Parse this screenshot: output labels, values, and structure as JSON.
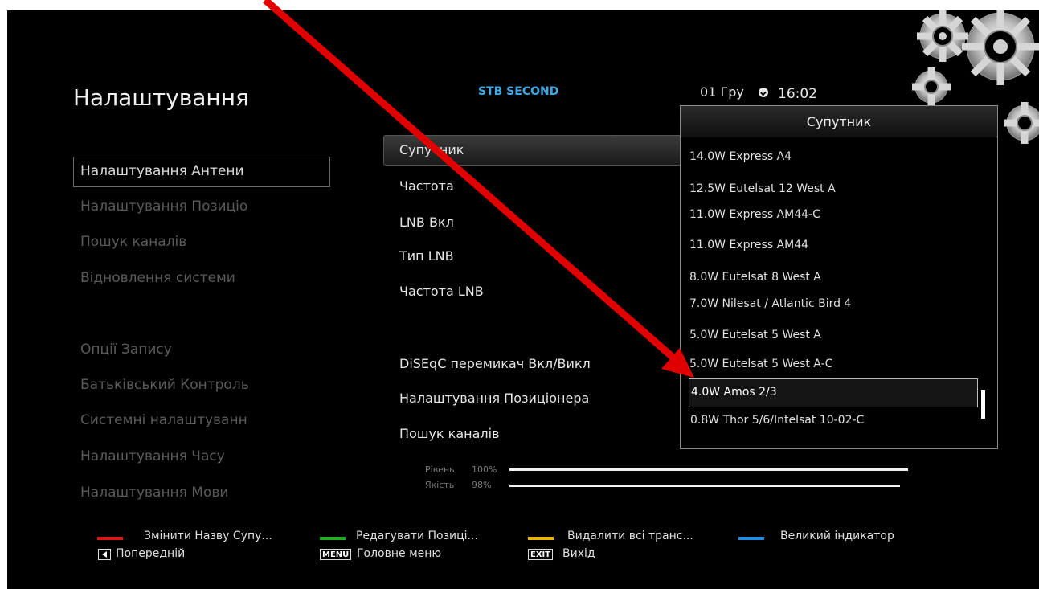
{
  "header": {
    "title": "Налаштування",
    "device_name": "STB SECOND",
    "date": "01 Гру",
    "time": "16:02"
  },
  "left_menu": {
    "items": [
      {
        "label": "Налаштування Антени",
        "active": true
      },
      {
        "label": "Налаштування Позиціо",
        "active": false
      },
      {
        "label": "Пошук каналів",
        "active": false
      },
      {
        "label": "Відновлення системи",
        "active": false
      },
      {
        "label": "Опції Запису",
        "active": false
      },
      {
        "label": "Батьківський Контроль",
        "active": false
      },
      {
        "label": "Системні налаштуванн",
        "active": false
      },
      {
        "label": "Налаштування Часу",
        "active": false
      },
      {
        "label": "Налаштування Мови",
        "active": false
      }
    ]
  },
  "settings": {
    "items": [
      {
        "label": "Супутник",
        "selected": true
      },
      {
        "label": "Частота"
      },
      {
        "label": "LNB Вкл"
      },
      {
        "label": "Тип LNB"
      },
      {
        "label": "Частота LNB"
      },
      {
        "label": "DiSEqC перемикач Вкл/Викл"
      },
      {
        "label": "Налаштування Позиціонера"
      },
      {
        "label": "Пошук каналів"
      }
    ]
  },
  "signal": {
    "level_label": "Рівень",
    "level_value": "100%",
    "level_fraction": 1.0,
    "quality_label": "Якість",
    "quality_value": "98%",
    "quality_fraction": 0.98
  },
  "satellite_popup": {
    "title": "Супутник",
    "selected_index": 8,
    "items": [
      "14.0W Express A4",
      "12.5W Eutelsat 12 West A",
      "11.0W Express AM44-C",
      "11.0W Express AM44",
      "8.0W Eutelsat 8 West A",
      "7.0W Nilesat / Atlantic Bird 4",
      "5.0W Eutelsat 5 West A",
      "5.0W Eutelsat 5 West A-C",
      "4.0W Amos 2/3",
      "0.8W Thor 5/6/Intelsat 10-02-C"
    ]
  },
  "footer": {
    "red_label": "Змінити Назву Супу...",
    "green_label": "Редагувати Позиці...",
    "yellow_label": "Видалити всі транс...",
    "blue_label": "Великий індикатор",
    "back_key_icon": "left-arrow-icon",
    "back_label": "Попередній",
    "menu_key": "MENU",
    "menu_label": "Головне меню",
    "exit_key": "EXIT",
    "exit_label": "Вихід",
    "colors": {
      "red": "#e01515",
      "green": "#22b022",
      "yellow": "#e8b400",
      "blue": "#1e8ee0"
    }
  },
  "annotation": {
    "arrow_color": "#e00000"
  }
}
